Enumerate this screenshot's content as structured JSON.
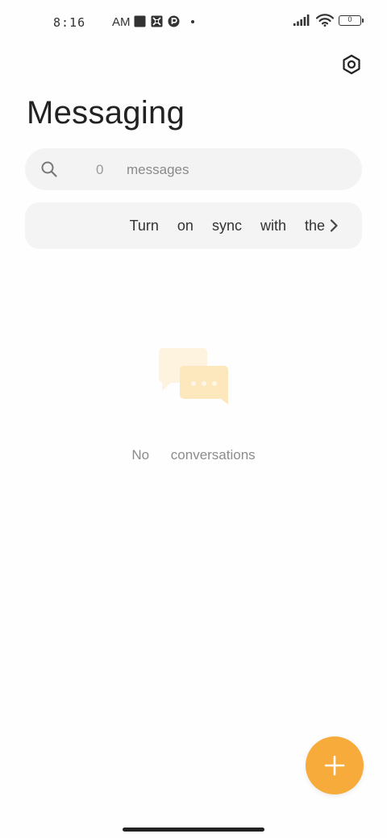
{
  "status_bar": {
    "time": "8:16",
    "ampm": "AM",
    "battery_level": "0",
    "notification_icons": [
      "square-notification-icon",
      "game-notification-icon",
      "app-notification-icon",
      "dot-icon"
    ],
    "system_icons": [
      "signal-icon",
      "wifi-icon",
      "battery-icon"
    ]
  },
  "header": {
    "title": "Messaging",
    "settings_icon": "settings-icon"
  },
  "search": {
    "count": "0",
    "placeholder": "messages",
    "icon": "search-icon"
  },
  "sync_banner": {
    "text": "Turn on sync with the",
    "icon": "chevron-right-icon"
  },
  "empty_state": {
    "text": "No conversations",
    "icon": "chat-bubbles-icon"
  },
  "fab": {
    "icon": "plus-icon",
    "color": "#f6ab3b"
  },
  "colors": {
    "accent": "#f6ab3b",
    "background": "#fefefe",
    "search_bg": "#f3f3f3"
  }
}
